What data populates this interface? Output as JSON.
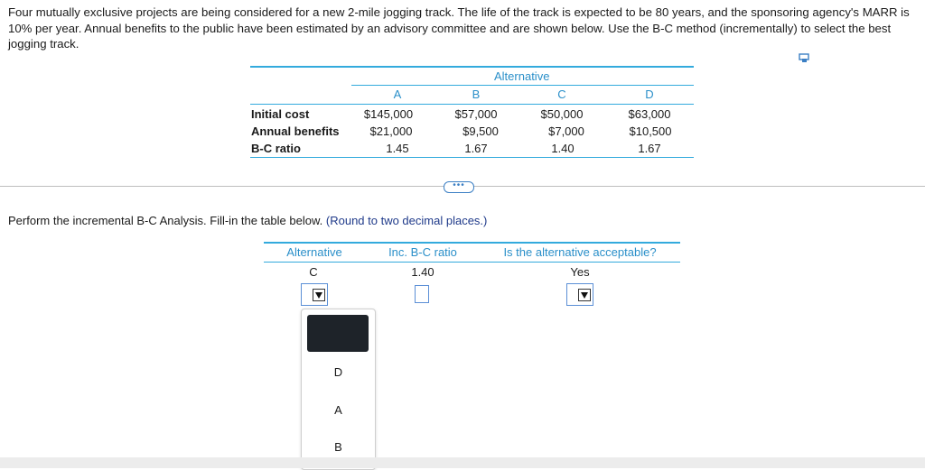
{
  "problem_text": "Four mutually exclusive projects are being considered for a new 2-mile jogging track. The life of the track is expected to be 80 years, and the sponsoring agency's MARR is 10% per year. Annual benefits to the public have been estimated by an advisory committee and are shown below. Use the B-C method (incrementally) to select the best jogging track.",
  "given_table": {
    "group_header": "Alternative",
    "columns": [
      "A",
      "B",
      "C",
      "D"
    ],
    "rows": [
      {
        "label": "Initial cost",
        "values": [
          "$145,000",
          "$57,000",
          "$50,000",
          "$63,000"
        ]
      },
      {
        "label": "Annual benefits",
        "values": [
          "$21,000",
          "$9,500",
          "$7,000",
          "$10,500"
        ]
      },
      {
        "label": "B-C ratio",
        "values": [
          "1.45",
          "1.67",
          "1.40",
          "1.67"
        ]
      }
    ]
  },
  "more_button_label": "•••",
  "instruction": {
    "text": "Perform the incremental B-C Analysis. Fill-in the table below.",
    "note": "(Round to two decimal places.)"
  },
  "answer_table": {
    "headers": [
      "Alternative",
      "Inc. B-C ratio",
      "Is the alternative acceptable?"
    ],
    "first_row": [
      "C",
      "1.40",
      "Yes"
    ]
  },
  "dropdown_menu": {
    "options": [
      "",
      "D",
      "A",
      "B"
    ]
  },
  "icons": {
    "copy": "copy-icon",
    "dropdown_arrow": "triangle-down-icon"
  },
  "colors": {
    "accent": "#33aadd",
    "header_text": "#2a8fc9",
    "instruction_note": "#1f3a8a",
    "input_border": "#5b8fd6",
    "selected_option": "#1e2329"
  }
}
